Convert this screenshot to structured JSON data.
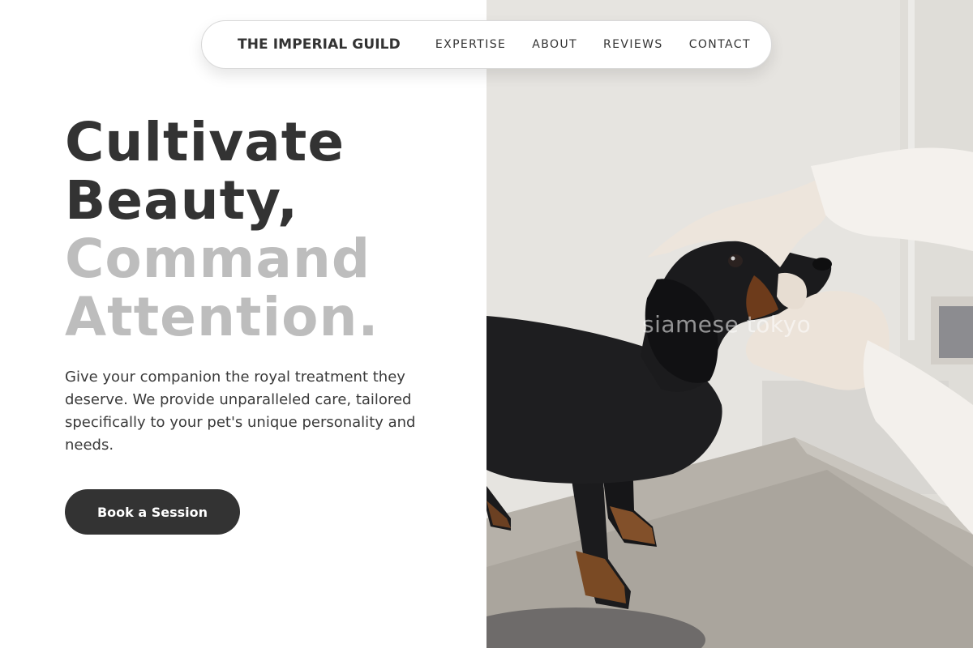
{
  "nav": {
    "brand": "THE IMPERIAL GUILD",
    "links": [
      "EXPERTISE",
      "ABOUT",
      "REVIEWS",
      "CONTACT"
    ]
  },
  "hero": {
    "headline_dark": [
      "Cultivate",
      "Beauty,"
    ],
    "headline_light": [
      "Command",
      "Attention."
    ],
    "description": "Give your companion the royal treatment they deserve. We provide unparalleled care, tailored specifically to your pet's unique personality and needs.",
    "cta_label": "Book a Session",
    "image_watermark": "siamese tokyo"
  },
  "colors": {
    "text_dark": "#333333",
    "text_light": "#bdbdbd",
    "button_bg": "#333333",
    "button_text": "#ffffff"
  },
  "icons": {
    "hero_image": "dog-grooming-photo"
  }
}
